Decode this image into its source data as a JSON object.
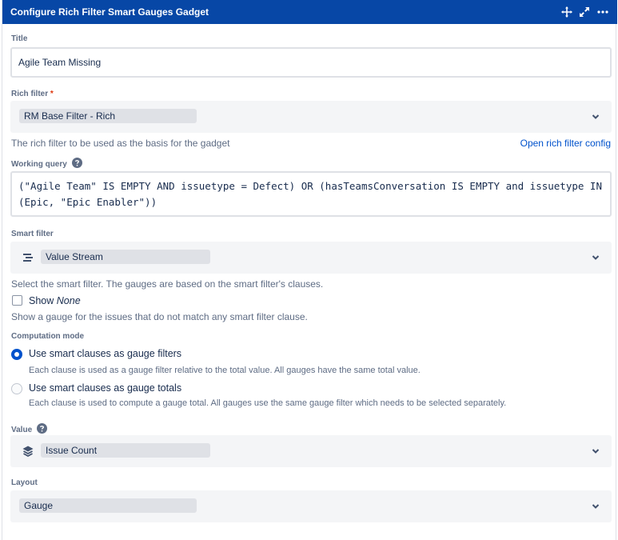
{
  "header": {
    "title": "Configure Rich Filter Smart Gauges Gadget",
    "icons": [
      "move-icon",
      "expand-icon",
      "more-icon"
    ]
  },
  "title_field": {
    "label": "Title",
    "value": "Agile Team Missing"
  },
  "rich_filter": {
    "label": "Rich filter",
    "required_mark": "*",
    "value": "RM Base Filter - Rich",
    "helper": "The rich filter to be used as the basis for the gadget",
    "link": "Open rich filter config"
  },
  "working_query": {
    "label": "Working query",
    "value": "(\"Agile Team\" IS EMPTY AND issuetype = Defect) OR (hasTeamsConversation IS EMPTY and issuetype IN (Epic, \"Epic Enabler\"))"
  },
  "smart_filter": {
    "label": "Smart filter",
    "value": "Value Stream",
    "helper": "Select the smart filter. The gauges are based on the smart filter's clauses.",
    "show_none_prefix": "Show",
    "show_none_em": "None",
    "show_none_checked": false,
    "show_none_helper": "Show a gauge for the issues that do not match any smart filter clause."
  },
  "computation_mode": {
    "label": "Computation mode",
    "options": [
      {
        "label": "Use smart clauses as gauge filters",
        "helper": "Each clause is used as a gauge filter relative to the total value. All gauges have the same total value.",
        "selected": true
      },
      {
        "label": "Use smart clauses as gauge totals",
        "helper": "Each clause is used to compute a gauge total. All gauges use the same gauge filter which needs to be selected separately.",
        "selected": false
      }
    ]
  },
  "value_field": {
    "label": "Value",
    "value": "Issue Count"
  },
  "layout_field": {
    "label": "Layout",
    "value": "Gauge"
  },
  "colors": {
    "header": "#0747a6",
    "accent": "#0052cc",
    "required": "#de350b"
  }
}
